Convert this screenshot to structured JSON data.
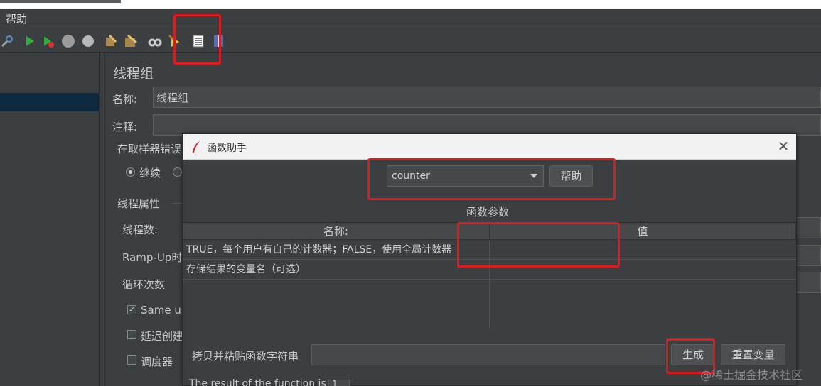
{
  "menu": {
    "help": "帮助"
  },
  "main": {
    "panel_title": "线程组",
    "name_label": "名称:",
    "name_value": "线程组",
    "comment_label": "注释:",
    "sampler_error_label": "在取样器错误",
    "continue_label": "继续",
    "thread_props_label": "线程属性",
    "thread_count_label": "线程数:",
    "rampup_label": "Ramp-Up时",
    "loop_label": "循环次数",
    "same_user_label": "Same us",
    "delay_create_label": "延迟创建",
    "scheduler_label": "调度器"
  },
  "dialog": {
    "title": "函数助手",
    "function_select_value": "counter",
    "help_button": "帮助",
    "params_section_label": "函数参数",
    "table": {
      "headers": [
        "名称:",
        "值"
      ],
      "rows": [
        {
          "name": "TRUE，每个用户有自己的计数器；FALSE，使用全局计数器",
          "value": ""
        },
        {
          "name": "存储结果的变量名（可选）",
          "value": ""
        }
      ]
    },
    "copy_paste_label": "拷贝并粘贴函数字符串",
    "copy_paste_value": "",
    "generate_button": "生成",
    "reset_button": "重置变量",
    "result_label": "The result of the function is",
    "result_value": "1"
  },
  "watermark": "@稀土掘金技术社区",
  "colors": {
    "highlight_red": "#e0191e",
    "selection": "#0d293e"
  }
}
